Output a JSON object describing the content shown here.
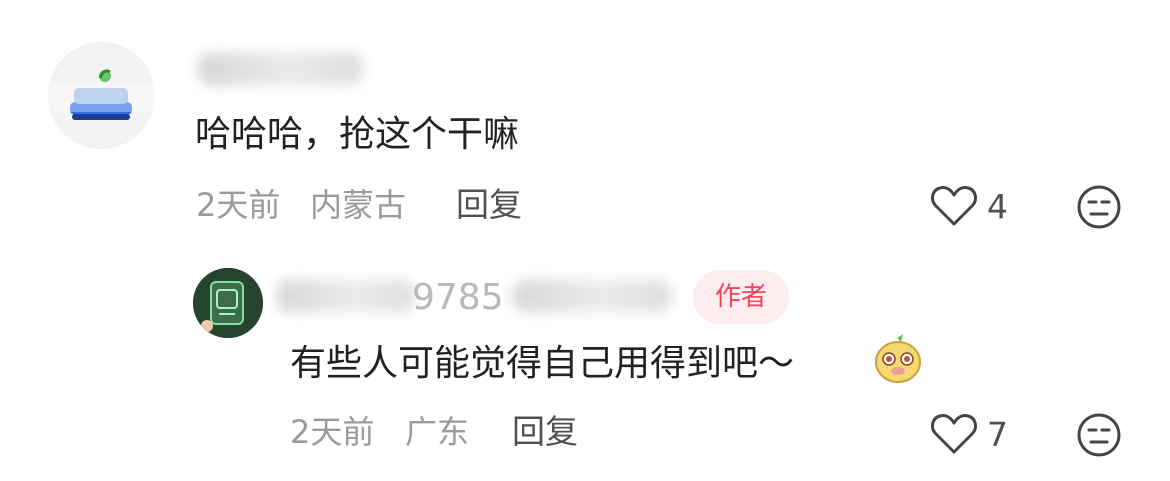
{
  "comments": [
    {
      "text": "哈哈哈，抢这个干嘛",
      "time": "2天前",
      "location": "内蒙古",
      "reply_label": "回复",
      "likes": "4"
    },
    {
      "username_visible": "9785",
      "badge": "作者",
      "text": "有些人可能觉得自己用得到吧～",
      "time": "2天前",
      "location": "广东",
      "reply_label": "回复",
      "likes": "7"
    }
  ]
}
